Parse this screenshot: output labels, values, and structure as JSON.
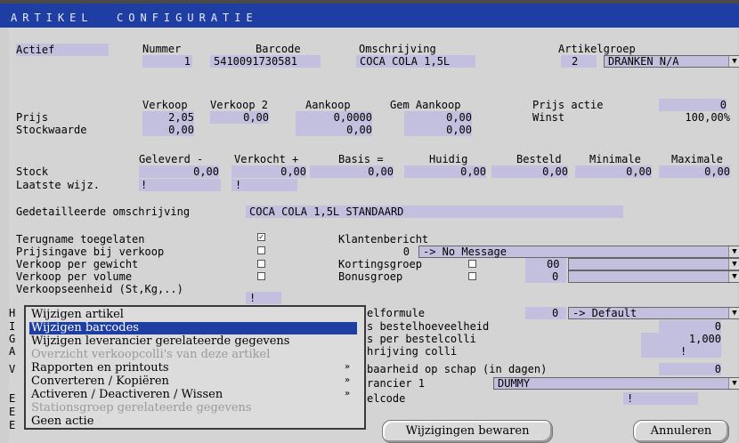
{
  "header": {
    "title": "ARTIKEL  CONFIGURATIE"
  },
  "top": {
    "status": "Actief",
    "nummer_label": "Nummer",
    "nummer": "1",
    "barcode_label": "Barcode",
    "barcode": "5410091730581",
    "omschrijving_label": "Omschrijving",
    "omschrijving": "COCA COLA 1,5L",
    "artikelgroep_label": "Artikelgroep",
    "artikelgroep_nr": "2",
    "artikelgroep_naam": "DRANKEN N/A"
  },
  "prices": {
    "headers": [
      "Verkoop",
      "Verkoop 2",
      "Aankoop",
      "Gem Aankoop"
    ],
    "prijs_label": "Prijs",
    "stockwaarde_label": "Stockwaarde",
    "prijs": [
      "2,05",
      "0,00",
      "0,0000",
      "0,00"
    ],
    "stockwaarde": [
      "0,00",
      "",
      "0,00",
      "0,00"
    ],
    "prijs_actie_label": "Prijs actie",
    "prijs_actie": "0",
    "winst_label": "Winst",
    "winst": "100,00%"
  },
  "stock": {
    "headers": [
      "Geleverd -",
      "Verkocht +",
      "Basis =",
      "Huidig",
      "Besteld",
      "Minimale",
      "Maximale"
    ],
    "stock_label": "Stock",
    "values": [
      "0,00",
      "0,00",
      "0,00",
      "0,00",
      "0,00",
      "0,00",
      "0,00"
    ],
    "laatste_label": "Laatste wijz.",
    "laatste_values": [
      "!",
      "!"
    ]
  },
  "detail": {
    "label": "Gedetailleerde omschrijving",
    "value": "COCA COLA 1,5L STANDAARD"
  },
  "options": {
    "terugname": "Terugname toegelaten",
    "prijsingave": "Prijsingave bij verkoop",
    "gewicht": "Verkoop per gewicht",
    "volume": "Verkoop per volume",
    "eenheid": "Verkoopseenheid (St,Kg,..)",
    "eenheid_value": "!",
    "checked_mark": "✓"
  },
  "right": {
    "klantenbericht_label": "Klantenbericht",
    "klantenbericht_nr": "0",
    "klantenbericht_value": "-> No Message",
    "kortingsgroep_label": "Kortingsgroep",
    "kortingsgroep_nr": "00",
    "bonusgroep_label": "Bonusgroep",
    "bonusgroep_nr": "0",
    "formule_label": "elformule",
    "formule_nr": "0",
    "formule_value": "-> Default",
    "bestelhoeveelheid_label": "s bestelhoeveelheid",
    "bestelhoeveelheid": "0",
    "per_colli_label": "s per bestelcolli",
    "per_colli": "1,000",
    "omschr_colli_label": "hrijving colli",
    "omschr_colli": "!",
    "houdbaarheid_label": "baarheid op schap (in dagen)",
    "houdbaarheid": "0",
    "leverancier_label": "rancier 1",
    "leverancier": "DUMMY",
    "bestelcode_label": "elcode",
    "bestelcode": "!"
  },
  "left_fragments": [
    "H",
    "I",
    "G",
    "A",
    "V",
    "E",
    "E",
    "E"
  ],
  "menu": {
    "items": [
      {
        "label": "Wijzigen artikel"
      },
      {
        "label": "Wijzigen barcodes"
      },
      {
        "label": "Wijzigen leverancier gerelateerde gegevens"
      },
      {
        "label": "Overzicht verkoopcolli's van deze artikel"
      },
      {
        "label": "Rapporten en printouts",
        "arrow": "»"
      },
      {
        "label": "Converteren / Kopiëren",
        "arrow": "»"
      },
      {
        "label": "Activeren / Deactiveren / Wissen",
        "arrow": "»"
      },
      {
        "label": "Stationsgroep gerelateerde gegevens"
      },
      {
        "label": "Geen actie"
      }
    ]
  },
  "buttons": {
    "save": "Wijzigingen bewaren",
    "cancel": "Annuleren"
  },
  "icons": {
    "dropdown": "▼"
  }
}
